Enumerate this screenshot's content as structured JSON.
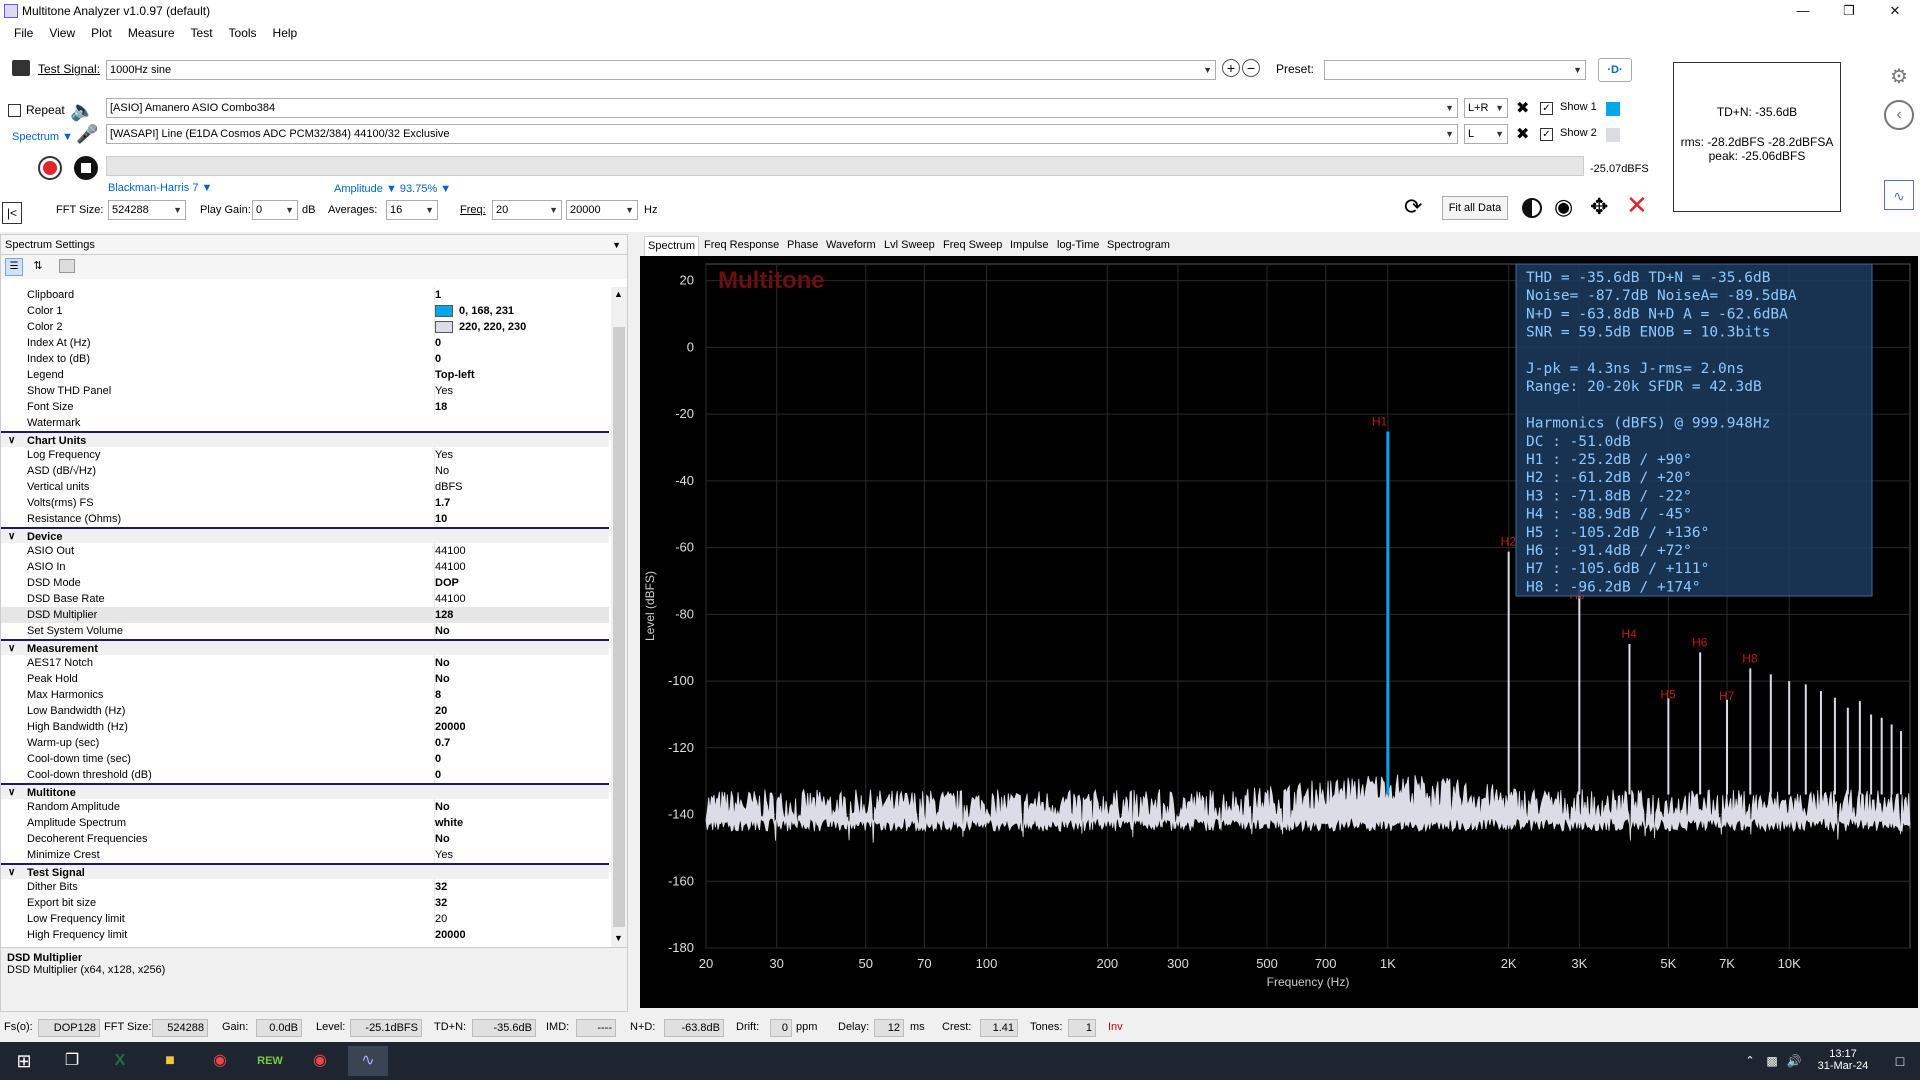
{
  "window": {
    "title": "Multitone Analyzer v1.0.97 (default)"
  },
  "menu": [
    "File",
    "View",
    "Plot",
    "Measure",
    "Test",
    "Tools",
    "Help"
  ],
  "controls": {
    "test_signal_label": "Test Signal:",
    "test_signal_value": "1000Hz sine",
    "preset_label": "Preset:",
    "preset_value": "",
    "repeat_label": "Repeat",
    "spectrum_label": "Spectrum",
    "asio_out": "[ASIO] Amanero ASIO Combo384",
    "asio_in": "[WASAPI] Line (E1DA Cosmos ADC PCM32/384) 44100/32 Exclusive",
    "channel_out": "L+R",
    "channel_in": "L",
    "show1": "Show 1",
    "show2": "Show 2",
    "show1_color": "#00a8e7",
    "show2_color": "#dcdce6",
    "level_readout": "-25.07dBFS",
    "window_fn": "Blackman-Harris 7",
    "amplitude": "Amplitude",
    "amplitude_pct": "93.75%",
    "fft_size_label": "FFT Size:",
    "fft_size": "524288",
    "play_gain_label": "Play Gain:",
    "play_gain": "0",
    "db": "dB",
    "averages_label": "Averages:",
    "averages": "16",
    "freq_label": "Freq:",
    "freq_lo": "20",
    "freq_hi": "20000",
    "hz": "Hz",
    "fit_all": "Fit all Data"
  },
  "infobox": {
    "tdn": "TD+N: -35.6dB",
    "rms": "rms: -28.2dBFS  -28.2dBFSA",
    "peak": "peak: -25.06dBFS"
  },
  "panel": {
    "title": "Spectrum Settings",
    "rows": [
      {
        "name": "Clipboard",
        "value": "1",
        "bold": true
      },
      {
        "name": "Color 1",
        "value": "0, 168, 231",
        "swatch": "#00a8e7",
        "bold": true
      },
      {
        "name": "Color 2",
        "value": "220, 220, 230",
        "swatch": "#dcdce6",
        "bold": true
      },
      {
        "name": "Index At (Hz)",
        "value": "0",
        "bold": true
      },
      {
        "name": "Index to (dB)",
        "value": "0",
        "bold": true
      },
      {
        "name": "Legend",
        "value": "Top-left",
        "bold": true
      },
      {
        "name": "Show THD Panel",
        "value": "Yes"
      },
      {
        "name": "Font Size",
        "value": "18",
        "bold": true
      },
      {
        "name": "Watermark",
        "value": ""
      },
      {
        "cat": "Chart Units"
      },
      {
        "name": "Log Frequency",
        "value": "Yes"
      },
      {
        "name": "ASD (dB/√Hz)",
        "value": "No"
      },
      {
        "name": "Vertical units",
        "value": "dBFS"
      },
      {
        "name": "Volts(rms) FS",
        "value": "1.7",
        "bold": true
      },
      {
        "name": "Resistance (Ohms)",
        "value": "10",
        "bold": true
      },
      {
        "cat": "Device"
      },
      {
        "name": "ASIO Out",
        "value": "44100"
      },
      {
        "name": "ASIO In",
        "value": "44100"
      },
      {
        "name": "DSD Mode",
        "value": "DOP",
        "bold": true
      },
      {
        "name": "DSD Base Rate",
        "value": "44100"
      },
      {
        "name": "DSD Multiplier",
        "value": "128",
        "bold": true,
        "sel": true
      },
      {
        "name": "Set System Volume",
        "value": "No",
        "bold": true
      },
      {
        "cat": "Measurement"
      },
      {
        "name": "AES17 Notch",
        "value": "No",
        "bold": true
      },
      {
        "name": "Peak Hold",
        "value": "No",
        "bold": true
      },
      {
        "name": "Max Harmonics",
        "value": "8",
        "bold": true
      },
      {
        "name": "Low Bandwidth (Hz)",
        "value": "20",
        "bold": true
      },
      {
        "name": "High Bandwidth (Hz)",
        "value": "20000",
        "bold": true
      },
      {
        "name": "Warm-up (sec)",
        "value": "0.7",
        "bold": true
      },
      {
        "name": "Cool-down time (sec)",
        "value": "0",
        "bold": true
      },
      {
        "name": "Cool-down threshold (dB)",
        "value": "0",
        "bold": true
      },
      {
        "cat": "Multitone"
      },
      {
        "name": "Random Amplitude",
        "value": "No",
        "bold": true
      },
      {
        "name": "Amplitude Spectrum",
        "value": "white",
        "bold": true
      },
      {
        "name": "Decoherent Frequencies",
        "value": "No",
        "bold": true
      },
      {
        "name": "Minimize Crest",
        "value": "Yes"
      },
      {
        "cat": "Test Signal"
      },
      {
        "name": "Dither Bits",
        "value": "32",
        "bold": true
      },
      {
        "name": "Export bit size",
        "value": "32",
        "bold": true
      },
      {
        "name": "Low Frequency limit",
        "value": "20"
      },
      {
        "name": "High Frequency limit",
        "value": "20000",
        "bold": true
      }
    ],
    "desc_title": "DSD Multiplier",
    "desc_text": "DSD Multiplier (x64, x128, x256)"
  },
  "tabs": [
    "Spectrum",
    "Freq Response",
    "Phase",
    "Waveform",
    "Lvl Sweep",
    "Freq Sweep",
    "Impulse",
    "log-Time",
    "Spectrogram"
  ],
  "chart_data": {
    "type": "line",
    "watermark": "Multitone",
    "xlabel": "Frequency (Hz)",
    "ylabel": "Level (dBFS)",
    "x_scale": "log",
    "xlim": [
      20,
      20000
    ],
    "ylim": [
      -180,
      25
    ],
    "x_ticks": [
      20,
      30,
      50,
      70,
      100,
      200,
      300,
      500,
      700,
      1000,
      2000,
      3000,
      5000,
      7000,
      10000
    ],
    "x_tick_labels": [
      "20",
      "30",
      "50",
      "70",
      "100",
      "200",
      "300",
      "500",
      "700",
      "1K",
      "2K",
      "3K",
      "5K",
      "7K",
      "10K"
    ],
    "y_ticks": [
      20,
      0,
      -20,
      -40,
      -60,
      -80,
      -100,
      -120,
      -140,
      -160,
      -180
    ],
    "noise_floor_db": -137,
    "harmonics": [
      {
        "label": "H1",
        "freq": 1000,
        "level": -25.2
      },
      {
        "label": "H2",
        "freq": 2000,
        "level": -61.2
      },
      {
        "label": "H3",
        "freq": 3000,
        "level": -71.8
      },
      {
        "label": "H4",
        "freq": 4000,
        "level": -88.9
      },
      {
        "label": "H5",
        "freq": 5000,
        "level": -105.2
      },
      {
        "label": "H6",
        "freq": 6000,
        "level": -91.4
      },
      {
        "label": "H7",
        "freq": 7000,
        "level": -105.6
      },
      {
        "label": "H8",
        "freq": 8000,
        "level": -96.2
      }
    ],
    "extra_spurs": [
      {
        "freq": 9000,
        "level": -98
      },
      {
        "freq": 10000,
        "level": -100
      },
      {
        "freq": 11000,
        "level": -101
      },
      {
        "freq": 12000,
        "level": -103
      },
      {
        "freq": 13000,
        "level": -105
      },
      {
        "freq": 14000,
        "level": -108
      },
      {
        "freq": 15000,
        "level": -106
      },
      {
        "freq": 16000,
        "level": -110
      },
      {
        "freq": 17000,
        "level": -111
      },
      {
        "freq": 18000,
        "level": -113
      },
      {
        "freq": 19000,
        "level": -115
      }
    ],
    "series_color": "#00a8e7",
    "noise_color": "#dcdce6"
  },
  "thd_panel": [
    "THD   = -35.6dB    TD+N  = -35.6dB",
    "Noise= -87.7dB    NoiseA= -89.5dBA",
    "N+D   = -63.8dB    N+D A = -62.6dBA",
    "SNR   = 59.5dB    ENOB  = 10.3bits",
    "",
    "J-pk =   4.3ns    J-rms=   2.0ns",
    "Range:  20-20k    SFDR =  42.3dB",
    "",
    "Harmonics (dBFS) @ 999.948Hz",
    "DC :    -51.0dB",
    "H1 :    -25.2dB  /  +90°",
    "H2 :    -61.2dB  /  +20°",
    "H3 :    -71.8dB  /  -22°",
    "H4 :    -88.9dB  /  -45°",
    "H5 :   -105.2dB  / +136°",
    "H6 :    -91.4dB  /  +72°",
    "H7 :   -105.6dB  / +111°",
    "H8 :    -96.2dB  / +174°"
  ],
  "status": {
    "fs_label": "Fs(o):",
    "fs": "DOP128",
    "fft_label": "FFT Size:",
    "fft": "524288",
    "gain_label": "Gain:",
    "gain": "0.0dB",
    "level_label": "Level:",
    "level": "-25.1dBFS",
    "tdn_label": "TD+N:",
    "tdn": "-35.6dB",
    "imd_label": "IMD:",
    "imd": "----",
    "nd_label": "N+D:",
    "nd": "-63.8dB",
    "drift_label": "Drift:",
    "drift": "0",
    "ppm": "ppm",
    "delay_label": "Delay:",
    "delay": "12",
    "ms": "ms",
    "crest_label": "Crest:",
    "crest": "1.41",
    "tones_label": "Tones:",
    "tones": "1",
    "inv": "Inv"
  },
  "taskbar": {
    "time": "13:17",
    "date": "31-Mar-24"
  }
}
